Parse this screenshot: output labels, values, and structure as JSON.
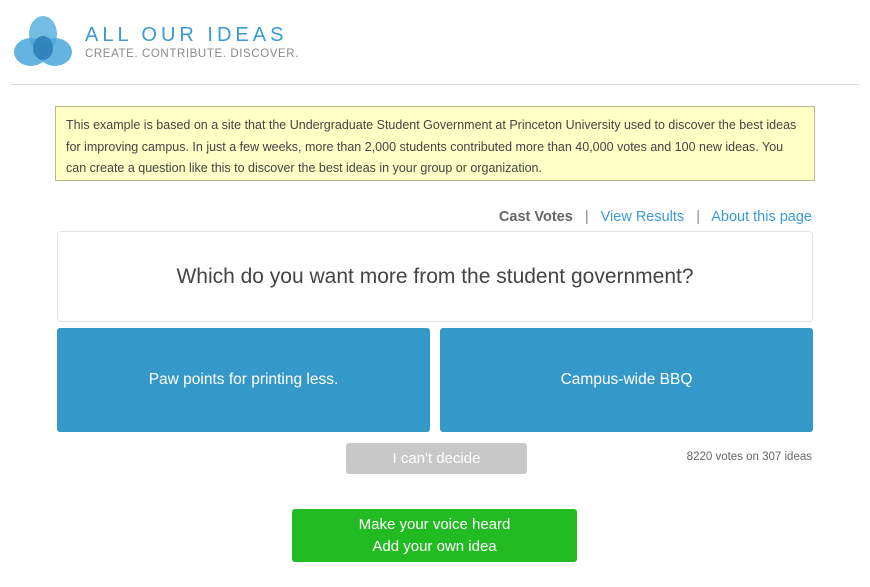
{
  "brand": {
    "title": "ALL OUR IDEAS",
    "tagline": "CREATE. CONTRIBUTE. DISCOVER.",
    "logo_icon": "triquetra-logo-icon",
    "accent_color": "#3a9ad4"
  },
  "notice": {
    "text": "This example is based on a site that the Undergraduate Student Government at Princeton University used to discover the best ideas for improving campus. In just a few weeks, more than 2,000 students contributed more than 40,000 votes and 100 new ideas. You can create a question like this to discover the best ideas in your group or organization."
  },
  "nav": {
    "cast_votes": "Cast Votes",
    "separator": "|",
    "view_results": "View Results",
    "about": "About this page"
  },
  "question": {
    "text": "Which do you want more from the student government?"
  },
  "choices": {
    "left": "Paw points for printing less.",
    "right": "Campus-wide BBQ",
    "color": "#3499c8"
  },
  "cant_decide": {
    "label": "I can't decide"
  },
  "stats": {
    "text": "8220 votes on 307 ideas"
  },
  "add_idea": {
    "line1": "Make your voice heard",
    "line2": "Add your own idea",
    "color": "#22bb22"
  }
}
